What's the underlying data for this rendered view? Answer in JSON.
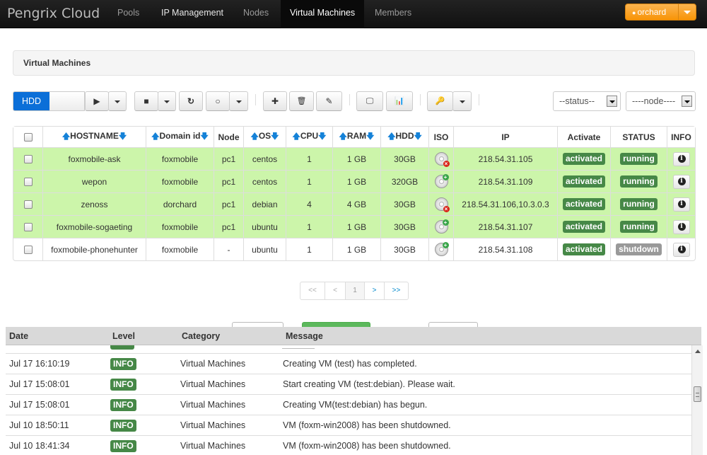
{
  "topbar": {
    "brand": "Pengrix Cloud",
    "nav": [
      {
        "label": "Pools",
        "state": "dim"
      },
      {
        "label": "IP Management",
        "state": "light"
      },
      {
        "label": "Nodes",
        "state": "dim"
      },
      {
        "label": "Virtual Machines",
        "state": "active"
      },
      {
        "label": "Members",
        "state": "dim"
      }
    ],
    "user": "orchard",
    "user_icon": "user-icon"
  },
  "panel": {
    "title": "Virtual Machines"
  },
  "toolbar": {
    "hdd_label": "HDD",
    "status_filter": "--status--",
    "node_filter": "----node----",
    "icons": {
      "play": "▶",
      "stop": "■",
      "refresh": "↻",
      "power": "○",
      "add": "✚",
      "delete": "🗑",
      "edit": "✎",
      "console": "🖵",
      "monitor": "📊",
      "key": "🔑"
    }
  },
  "table": {
    "headers": {
      "hostname": "HOSTNAME",
      "domain": "Domain id",
      "node": "Node",
      "os": "OS",
      "cpu": "CPU",
      "ram": "RAM",
      "hdd": "HDD",
      "iso": "ISO",
      "ip": "IP",
      "activate": "Activate",
      "status": "STATUS",
      "info": "INFO"
    },
    "rows": [
      {
        "hostname": "foxmobile-ask",
        "domain": "foxmobile",
        "node": "pc1",
        "os": "centos",
        "cpu": "1",
        "ram": "1 GB",
        "hdd": "30GB",
        "iso": "remove",
        "ip": "218.54.31.105",
        "activate": "activated",
        "status": "running",
        "running": true
      },
      {
        "hostname": "wepon",
        "domain": "foxmobile",
        "node": "pc1",
        "os": "centos",
        "cpu": "1",
        "ram": "1 GB",
        "hdd": "320GB",
        "iso": "attach",
        "ip": "218.54.31.109",
        "activate": "activated",
        "status": "running",
        "running": true
      },
      {
        "hostname": "zenoss",
        "domain": "dorchard",
        "node": "pc1",
        "os": "debian",
        "cpu": "4",
        "ram": "4 GB",
        "hdd": "30GB",
        "iso": "remove",
        "ip": "218.54.31.106,10.3.0.3",
        "activate": "activated",
        "status": "running",
        "running": true
      },
      {
        "hostname": "foxmobile-sogaeting",
        "domain": "foxmobile",
        "node": "pc1",
        "os": "ubuntu",
        "cpu": "1",
        "ram": "1 GB",
        "hdd": "30GB",
        "iso": "attach",
        "ip": "218.54.31.107",
        "activate": "activated",
        "status": "running",
        "running": true
      },
      {
        "hostname": "foxmobile-phonehunter",
        "domain": "foxmobile",
        "node": "-",
        "os": "ubuntu",
        "cpu": "1",
        "ram": "1 GB",
        "hdd": "30GB",
        "iso": "attach",
        "ip": "218.54.31.108",
        "activate": "activated",
        "status": "shutdown",
        "running": false
      }
    ]
  },
  "pager": {
    "first": "<<",
    "prev": "<",
    "page": "1",
    "next": ">",
    "last": ">>"
  },
  "log": {
    "headers": {
      "date": "Date",
      "level": "Level",
      "category": "Category",
      "message": "Message"
    },
    "rows": [
      {
        "date": "Jul 17 16:10:19",
        "level": "INFO",
        "category": "Virtual Machines",
        "message": "Creating VM (test) has completed."
      },
      {
        "date": "Jul 17 15:08:01",
        "level": "INFO",
        "category": "Virtual Machines",
        "message": "Start creating VM (test:debian). Please wait."
      },
      {
        "date": "Jul 17 15:08:01",
        "level": "INFO",
        "category": "Virtual Machines",
        "message": "Creating VM(test:debian) has begun."
      },
      {
        "date": "Jul 10 18:50:11",
        "level": "INFO",
        "category": "Virtual Machines",
        "message": "VM (foxm-win2008) has been shutdowned."
      },
      {
        "date": "Jul 10 18:41:34",
        "level": "INFO",
        "category": "Virtual Machines",
        "message": "VM (foxm-win2008) has been shutdowned."
      }
    ]
  },
  "colors": {
    "accent": "#0b6fd8",
    "running_row": "#ccf5aa",
    "badge_green": "#468847",
    "badge_gray": "#999999",
    "user_button": "#f89406"
  }
}
